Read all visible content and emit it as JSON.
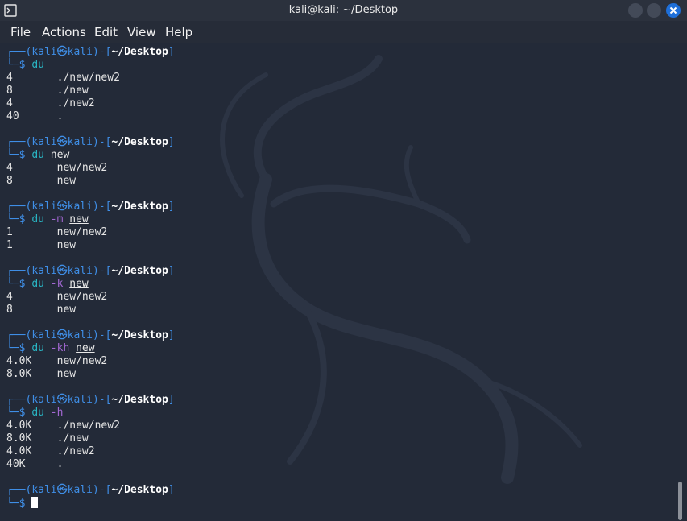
{
  "window": {
    "title": "kali@kali: ~/Desktop",
    "buttons": [
      "minimize",
      "maximize",
      "close"
    ]
  },
  "menu": {
    "items": [
      "File",
      "Actions",
      "Edit",
      "View",
      "Help"
    ]
  },
  "prompt": {
    "user": "kali",
    "at_symbol": "㉿",
    "host": "kali",
    "path": "~/Desktop",
    "dollar": "$"
  },
  "blocks": [
    {
      "command": "du",
      "flag": "",
      "arg": "",
      "output": [
        {
          "size": "4",
          "path": "./new/new2"
        },
        {
          "size": "8",
          "path": "./new"
        },
        {
          "size": "4",
          "path": "./new2"
        },
        {
          "size": "40",
          "path": "."
        }
      ]
    },
    {
      "command": "du",
      "flag": "",
      "arg": "new",
      "output": [
        {
          "size": "4",
          "path": "new/new2"
        },
        {
          "size": "8",
          "path": "new"
        }
      ]
    },
    {
      "command": "du",
      "flag": "-m",
      "arg": "new",
      "output": [
        {
          "size": "1",
          "path": "new/new2"
        },
        {
          "size": "1",
          "path": "new"
        }
      ]
    },
    {
      "command": "du",
      "flag": "-k",
      "arg": "new",
      "output": [
        {
          "size": "4",
          "path": "new/new2"
        },
        {
          "size": "8",
          "path": "new"
        }
      ]
    },
    {
      "command": "du",
      "flag": "-kh",
      "arg": "new",
      "output": [
        {
          "size": "4.0K",
          "path": "new/new2"
        },
        {
          "size": "8.0K",
          "path": "new"
        }
      ]
    },
    {
      "command": "du",
      "flag": "-h",
      "arg": "",
      "output": [
        {
          "size": "4.0K",
          "path": "./new/new2"
        },
        {
          "size": "8.0K",
          "path": "./new"
        },
        {
          "size": "4.0K",
          "path": "./new2"
        },
        {
          "size": "40K",
          "path": "."
        }
      ]
    }
  ],
  "colors": {
    "background": "#232a38",
    "prompt_frame": "#3f8ee6",
    "command": "#29b6c4",
    "flag": "#a268d2",
    "close_button": "#1e6fd9"
  }
}
